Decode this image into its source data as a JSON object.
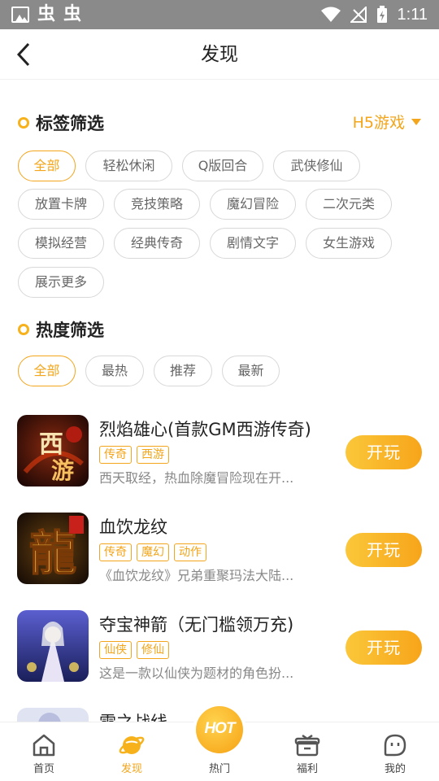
{
  "status_bar": {
    "time": "1:11"
  },
  "header": {
    "title": "发现"
  },
  "tag_filter": {
    "title": "标签筛选",
    "platform_label": "H5游戏",
    "tags": [
      "全部",
      "轻松休闲",
      "Q版回合",
      "武侠修仙",
      "放置卡牌",
      "竞技策略",
      "魔幻冒险",
      "二次元类",
      "模拟经营",
      "经典传奇",
      "剧情文字",
      "女生游戏",
      "展示更多"
    ],
    "selected": "全部"
  },
  "heat_filter": {
    "title": "热度筛选",
    "tags": [
      "全部",
      "最热",
      "推荐",
      "最新"
    ],
    "selected": "全部"
  },
  "games": [
    {
      "name": "烈焰雄心(首款GM西游传奇)",
      "labels": [
        "传奇",
        "西游"
      ],
      "desc": "西天取经，热血除魔冒险现在开...",
      "button": "开玩",
      "icon_text": "西游"
    },
    {
      "name": "血饮龙纹",
      "labels": [
        "传奇",
        "魔幻",
        "动作"
      ],
      "desc": "《血饮龙纹》兄弟重聚玛法大陆...",
      "button": "开玩",
      "icon_text": "龍"
    },
    {
      "name": "夺宝神箭（无门槛领万充)",
      "labels": [
        "仙侠",
        "修仙"
      ],
      "desc": "这是一款以仙侠为题材的角色扮...",
      "button": "开玩",
      "icon_text": ""
    },
    {
      "name": "雪之战线",
      "labels": [],
      "desc": "",
      "button": "",
      "icon_text": ""
    }
  ],
  "bottom_nav": {
    "items": [
      {
        "label": "首页",
        "icon": "home-icon"
      },
      {
        "label": "发现",
        "icon": "planet-icon",
        "active": true
      },
      {
        "label": "热门",
        "icon": "hot-icon"
      },
      {
        "label": "福利",
        "icon": "gift-icon"
      },
      {
        "label": "我的",
        "icon": "profile-icon"
      }
    ],
    "hot_badge": "HOT"
  },
  "colors": {
    "accent": "#f3a51b",
    "status_bar": "#8a8a8a"
  }
}
